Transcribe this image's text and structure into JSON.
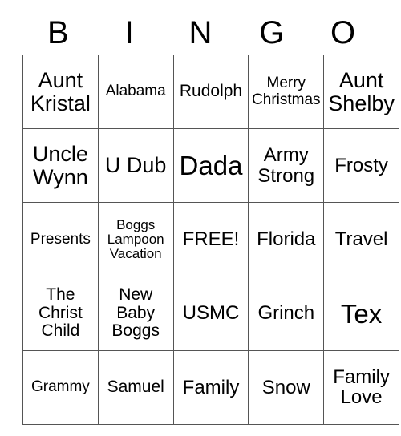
{
  "card": {
    "title_letters": [
      "B",
      "I",
      "N",
      "G",
      "O"
    ],
    "rows": [
      [
        {
          "text": "Aunt Kristal",
          "size": "s-xl"
        },
        {
          "text": "Alabama",
          "size": "s-sm"
        },
        {
          "text": "Rudolph",
          "size": "s-md"
        },
        {
          "text": "Merry Christmas",
          "size": "s-sm"
        },
        {
          "text": "Aunt Shelby",
          "size": "s-xl"
        }
      ],
      [
        {
          "text": "Uncle Wynn",
          "size": "s-xl"
        },
        {
          "text": "U Dub",
          "size": "s-xl"
        },
        {
          "text": "Dada",
          "size": "s-xxl"
        },
        {
          "text": "Army Strong",
          "size": "s-lg"
        },
        {
          "text": "Frosty",
          "size": "s-lg"
        }
      ],
      [
        {
          "text": "Presents",
          "size": "s-sm"
        },
        {
          "text": "Boggs Lampoon Vacation",
          "size": "s-xs"
        },
        {
          "text": "FREE!",
          "size": "s-lg"
        },
        {
          "text": "Florida",
          "size": "s-lg"
        },
        {
          "text": "Travel",
          "size": "s-lg"
        }
      ],
      [
        {
          "text": "The Christ Child",
          "size": "s-md"
        },
        {
          "text": "New Baby Boggs",
          "size": "s-md"
        },
        {
          "text": "USMC",
          "size": "s-lg"
        },
        {
          "text": "Grinch",
          "size": "s-lg"
        },
        {
          "text": "Tex",
          "size": "s-xxl"
        }
      ],
      [
        {
          "text": "Grammy",
          "size": "s-sm"
        },
        {
          "text": "Samuel",
          "size": "s-md"
        },
        {
          "text": "Family",
          "size": "s-lg"
        },
        {
          "text": "Snow",
          "size": "s-lg"
        },
        {
          "text": "Family Love",
          "size": "s-lg"
        }
      ]
    ]
  },
  "colors": {
    "background": "#ffffff",
    "text": "#000000",
    "grid_line": "#555555"
  }
}
